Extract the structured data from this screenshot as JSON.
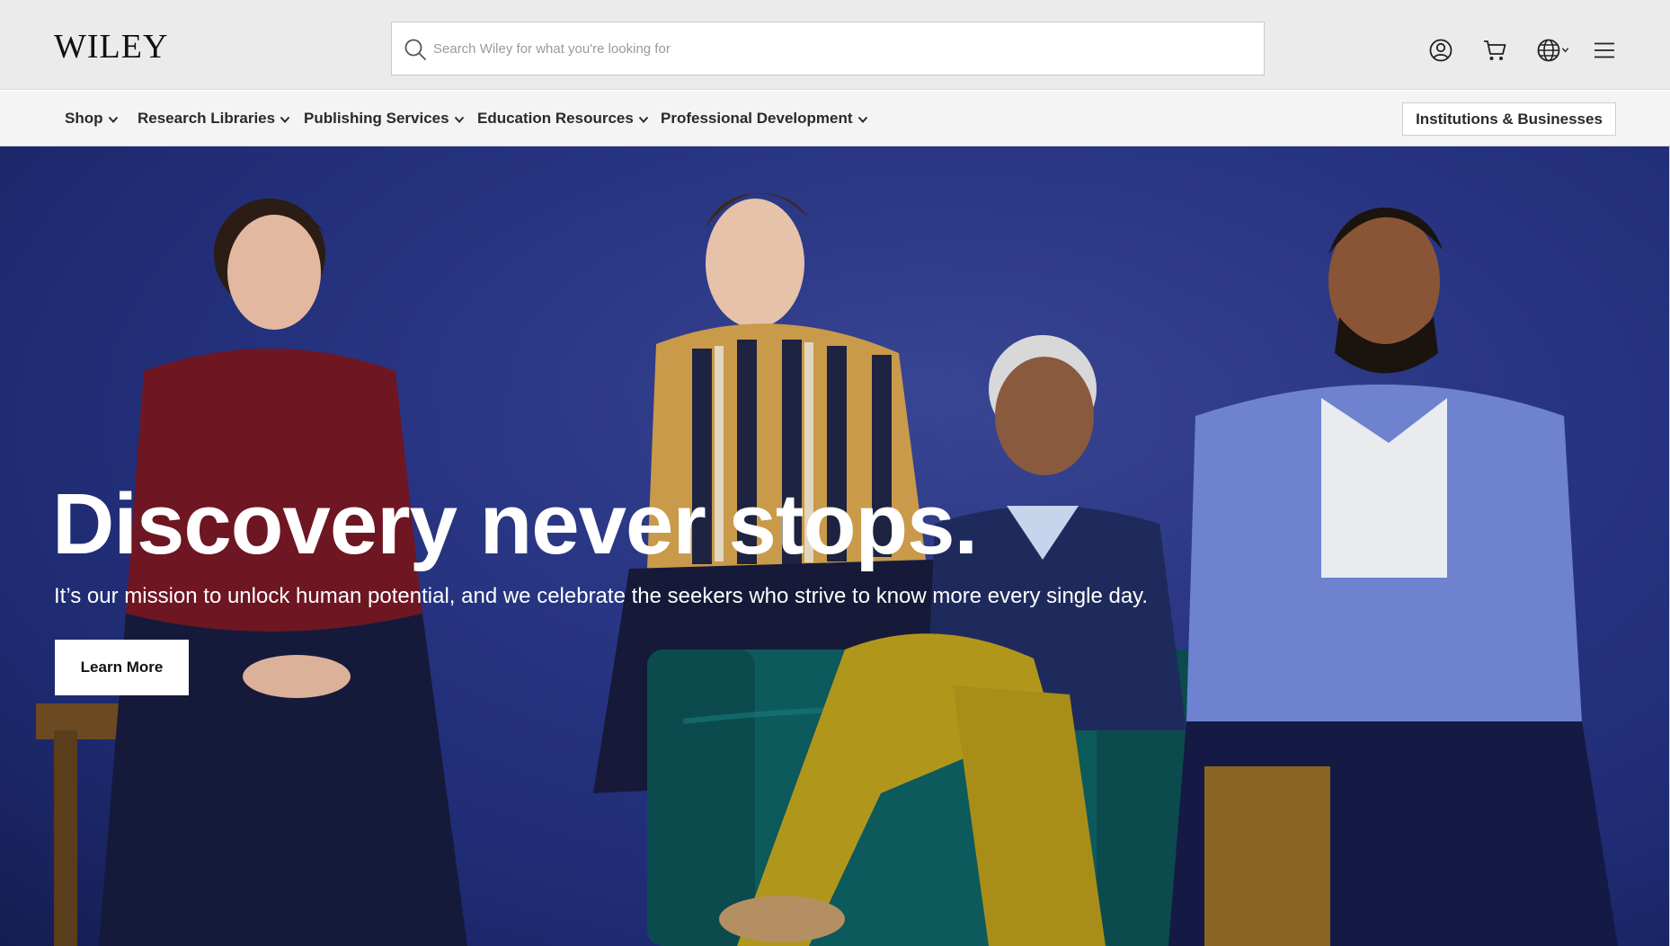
{
  "header": {
    "logo_text": "WILEY",
    "search_placeholder": "Search Wiley for what you're looking for",
    "icons": [
      "user-account-icon",
      "shopping-cart-icon",
      "globe-language-icon",
      "hamburger-menu-icon"
    ]
  },
  "nav": {
    "items": [
      {
        "label": "Shop"
      },
      {
        "label": "Research Libraries"
      },
      {
        "label": "Publishing Services"
      },
      {
        "label": "Education Resources"
      },
      {
        "label": "Professional Development"
      }
    ],
    "institutions_button": "Institutions & Businesses"
  },
  "hero": {
    "title": "Discovery never stops.",
    "subtitle": "It’s our mission to unlock human potential, and we celebrate the seekers who strive to know more every single day.",
    "cta_label": "Learn More"
  },
  "colors": {
    "header_bg": "#ebebeb",
    "nav_bg": "#f4f4f4",
    "hero_bg": "#283586",
    "hero_text": "#ffffff"
  }
}
